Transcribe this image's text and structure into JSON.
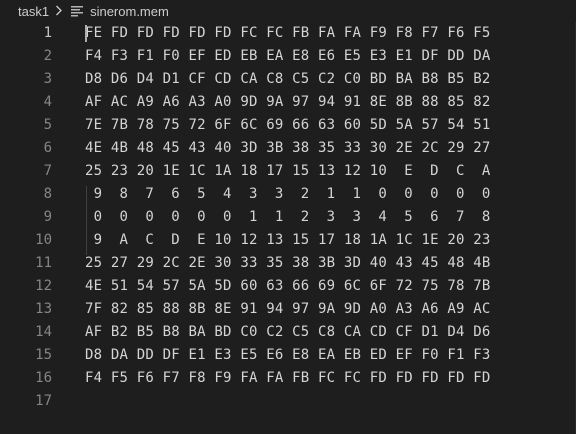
{
  "breadcrumb": {
    "folder": "task1",
    "separator_icon": "chevron-right-icon",
    "file_icon": "text-file-icon",
    "file": "sinerom.mem"
  },
  "editor": {
    "active_line": 1,
    "lines": [
      {
        "number": "1",
        "text": "FE FD FD FD FD FD FC FC FB FA FA F9 F8 F7 F6 F5"
      },
      {
        "number": "2",
        "text": "F4 F3 F1 F0 EF ED EB EA E8 E6 E5 E3 E1 DF DD DA"
      },
      {
        "number": "3",
        "text": "D8 D6 D4 D1 CF CD CA C8 C5 C2 C0 BD BA B8 B5 B2"
      },
      {
        "number": "4",
        "text": "AF AC A9 A6 A3 A0 9D 9A 97 94 91 8E 8B 88 85 82"
      },
      {
        "number": "5",
        "text": "7E 7B 78 75 72 6F 6C 69 66 63 60 5D 5A 57 54 51"
      },
      {
        "number": "6",
        "text": "4E 4B 48 45 43 40 3D 3B 38 35 33 30 2E 2C 29 27"
      },
      {
        "number": "7",
        "text": "25 23 20 1E 1C 1A 18 17 15 13 12 10  E  D  C  A"
      },
      {
        "number": "8",
        "text": " 9  8  7  6  5  4  3  3  2  1  1  0  0  0  0  0"
      },
      {
        "number": "9",
        "text": " 0  0  0  0  0  0  1  1  2  3  3  4  5  6  7  8"
      },
      {
        "number": "10",
        "text": " 9  A  C  D  E 10 12 13 15 17 18 1A 1C 1E 20 23"
      },
      {
        "number": "11",
        "text": "25 27 29 2C 2E 30 33 35 38 3B 3D 40 43 45 48 4B"
      },
      {
        "number": "12",
        "text": "4E 51 54 57 5A 5D 60 63 66 69 6C 6F 72 75 78 7B"
      },
      {
        "number": "13",
        "text": "7F 82 85 88 8B 8E 91 94 97 9A 9D A0 A3 A6 A9 AC"
      },
      {
        "number": "14",
        "text": "AF B2 B5 B8 BA BD C0 C2 C5 C8 CA CD CF D1 D4 D6"
      },
      {
        "number": "15",
        "text": "D8 DA DD DF E1 E3 E5 E6 E8 EA EB ED EF F0 F1 F3"
      },
      {
        "number": "16",
        "text": "F4 F5 F6 F7 F8 F9 FA FA FB FC FC FD FD FD FD FD"
      },
      {
        "number": "17",
        "text": ""
      }
    ]
  },
  "colors": {
    "background": "#1e1e1e",
    "text": "#d4d4d4",
    "line_number": "#858585",
    "active_line_number": "#c6c6c6",
    "file_icon": "#b4b4b4"
  }
}
